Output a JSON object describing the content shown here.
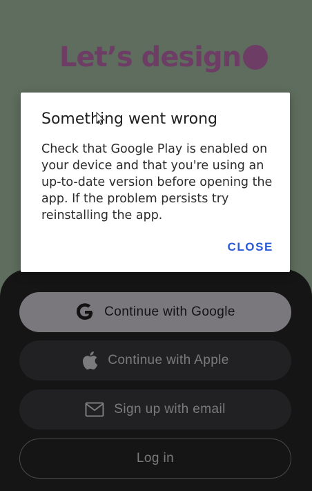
{
  "logo": {
    "text": "Let’s design"
  },
  "buttons": {
    "google": "Continue with Google",
    "apple": "Continue with Apple",
    "email": "Sign up with email",
    "login": "Log in"
  },
  "dialog": {
    "title": "Something went wrong",
    "message": "Check that Google Play is enabled on your device and that you're using an up-to-date version before opening the app. If the problem persists try reinstalling the app.",
    "close_label": "CLOSE"
  },
  "colors": {
    "background": "#5e6d5e",
    "brand": "#6e3d65",
    "sheet": "#151516",
    "accent": "#2a5bd7"
  },
  "icons": [
    "google-icon",
    "apple-icon",
    "mail-icon",
    "cursor-icon"
  ]
}
